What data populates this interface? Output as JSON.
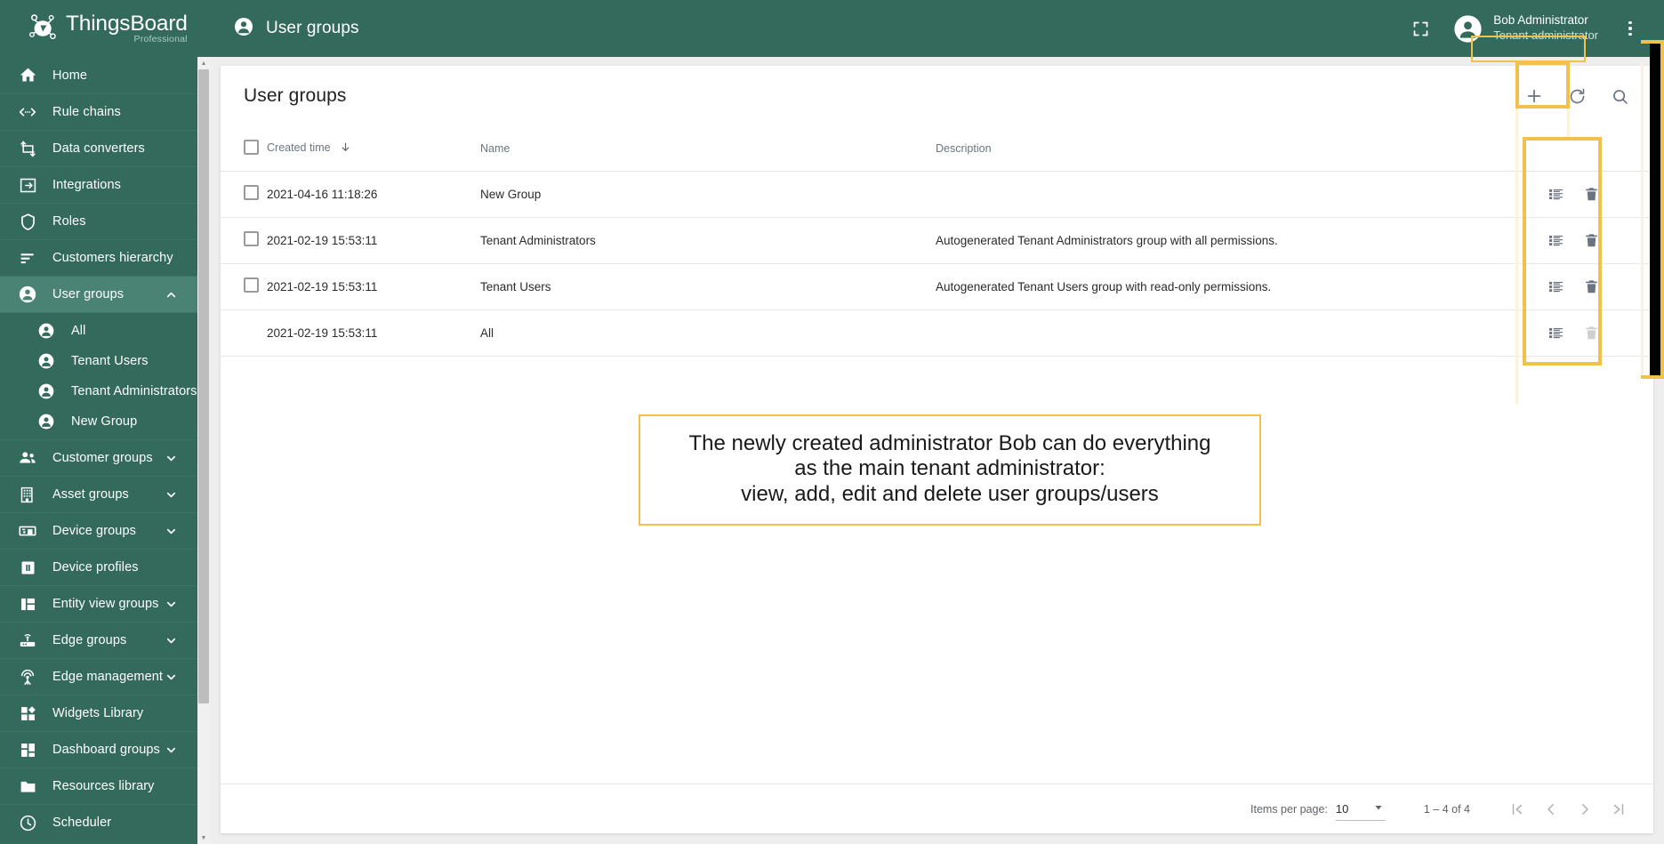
{
  "brand": {
    "title": "ThingsBoard",
    "subtitle": "Professional",
    "logo_icon": "thingsboard-logo-icon"
  },
  "sidebar": {
    "items": [
      {
        "label": "Home",
        "icon": "home-icon",
        "expandable": false,
        "active": false
      },
      {
        "label": "Rule chains",
        "icon": "rule-chains-icon",
        "expandable": false,
        "active": false
      },
      {
        "label": "Data converters",
        "icon": "data-converters-icon",
        "expandable": false,
        "active": false
      },
      {
        "label": "Integrations",
        "icon": "integrations-icon",
        "expandable": false,
        "active": false
      },
      {
        "label": "Roles",
        "icon": "shield-icon",
        "expandable": false,
        "active": false
      },
      {
        "label": "Customers hierarchy",
        "icon": "hierarchy-icon",
        "expandable": false,
        "active": false
      },
      {
        "label": "User groups",
        "icon": "user-icon",
        "expandable": true,
        "expanded": true,
        "active": true
      },
      {
        "label": "Customer groups",
        "icon": "customers-icon",
        "expandable": true,
        "expanded": false,
        "active": false
      },
      {
        "label": "Asset groups",
        "icon": "asset-icon",
        "expandable": true,
        "expanded": false,
        "active": false
      },
      {
        "label": "Device groups",
        "icon": "device-icon",
        "expandable": true,
        "expanded": false,
        "active": false
      },
      {
        "label": "Device profiles",
        "icon": "device-profile-icon",
        "expandable": false,
        "active": false
      },
      {
        "label": "Entity view groups",
        "icon": "entity-view-icon",
        "expandable": true,
        "expanded": false,
        "active": false
      },
      {
        "label": "Edge groups",
        "icon": "edge-router-icon",
        "expandable": true,
        "expanded": false,
        "active": false
      },
      {
        "label": "Edge management",
        "icon": "edge-management-icon",
        "expandable": true,
        "expanded": false,
        "active": false
      },
      {
        "label": "Widgets Library",
        "icon": "widgets-icon",
        "expandable": false,
        "active": false
      },
      {
        "label": "Dashboard groups",
        "icon": "dashboard-icon",
        "expandable": true,
        "expanded": false,
        "active": false
      },
      {
        "label": "Resources library",
        "icon": "folder-icon",
        "expandable": false,
        "active": false
      },
      {
        "label": "Scheduler",
        "icon": "clock-icon",
        "expandable": false,
        "active": false
      }
    ],
    "user_groups_children": [
      {
        "label": "All",
        "icon": "user-icon"
      },
      {
        "label": "Tenant Users",
        "icon": "user-icon"
      },
      {
        "label": "Tenant Administrators",
        "icon": "user-icon"
      },
      {
        "label": "New Group",
        "icon": "user-icon"
      }
    ]
  },
  "topbar": {
    "title": "User groups",
    "title_icon": "user-icon",
    "fullscreen_icon": "fullscreen-icon",
    "avatar_icon": "account-circle-icon",
    "user_name": "Bob Administrator",
    "user_role": "Tenant administrator",
    "kebab_icon": "more-vert-icon"
  },
  "card": {
    "title": "User groups",
    "actions": {
      "add_icon": "plus-icon",
      "add_label": "+",
      "refresh_icon": "refresh-icon",
      "search_icon": "search-icon"
    }
  },
  "table": {
    "columns": [
      {
        "key": "check",
        "label": ""
      },
      {
        "key": "created",
        "label": "Created time",
        "sorted": "desc",
        "sort_icon": "arrow-down-icon"
      },
      {
        "key": "name",
        "label": "Name"
      },
      {
        "key": "description",
        "label": "Description"
      },
      {
        "key": "actions",
        "label": ""
      }
    ],
    "rows": [
      {
        "created": "2021-04-16 11:18:26",
        "name": "New Group",
        "description": "",
        "selectable": true,
        "manage_icon": "manage-users-icon",
        "delete_icon": "delete-icon",
        "delete_enabled": true
      },
      {
        "created": "2021-02-19 15:53:11",
        "name": "Tenant Administrators",
        "description": "Autogenerated Tenant Administrators group with all permissions.",
        "selectable": true,
        "manage_icon": "manage-users-icon",
        "delete_icon": "delete-icon",
        "delete_enabled": true
      },
      {
        "created": "2021-02-19 15:53:11",
        "name": "Tenant Users",
        "description": "Autogenerated Tenant Users group with read-only permissions.",
        "selectable": true,
        "manage_icon": "manage-users-icon",
        "delete_icon": "delete-icon",
        "delete_enabled": true
      },
      {
        "created": "2021-02-19 15:53:11",
        "name": "All",
        "description": "",
        "selectable": false,
        "manage_icon": "manage-users-icon",
        "delete_icon": "delete-icon",
        "delete_enabled": false
      }
    ]
  },
  "paginator": {
    "items_per_page_label": "Items per page:",
    "items_per_page_value": "10",
    "dropdown_icon": "caret-down-icon",
    "range_label": "1 – 4 of 4",
    "first_icon": "first-page-icon",
    "prev_icon": "prev-page-icon",
    "next_icon": "next-page-icon",
    "last_icon": "last-page-icon"
  },
  "annotation": {
    "callout_line1": "The newly created administrator Bob can do everything",
    "callout_line2": "as the main tenant administrator:",
    "callout_line3": "view, add, edit and delete user groups/users",
    "highlight_color": "#f2c14b"
  },
  "colors": {
    "brand_green": "#336a5c",
    "active_green": "#4a8374",
    "page_bg": "#eeeeee",
    "accent_yellow": "#f2c14b"
  }
}
